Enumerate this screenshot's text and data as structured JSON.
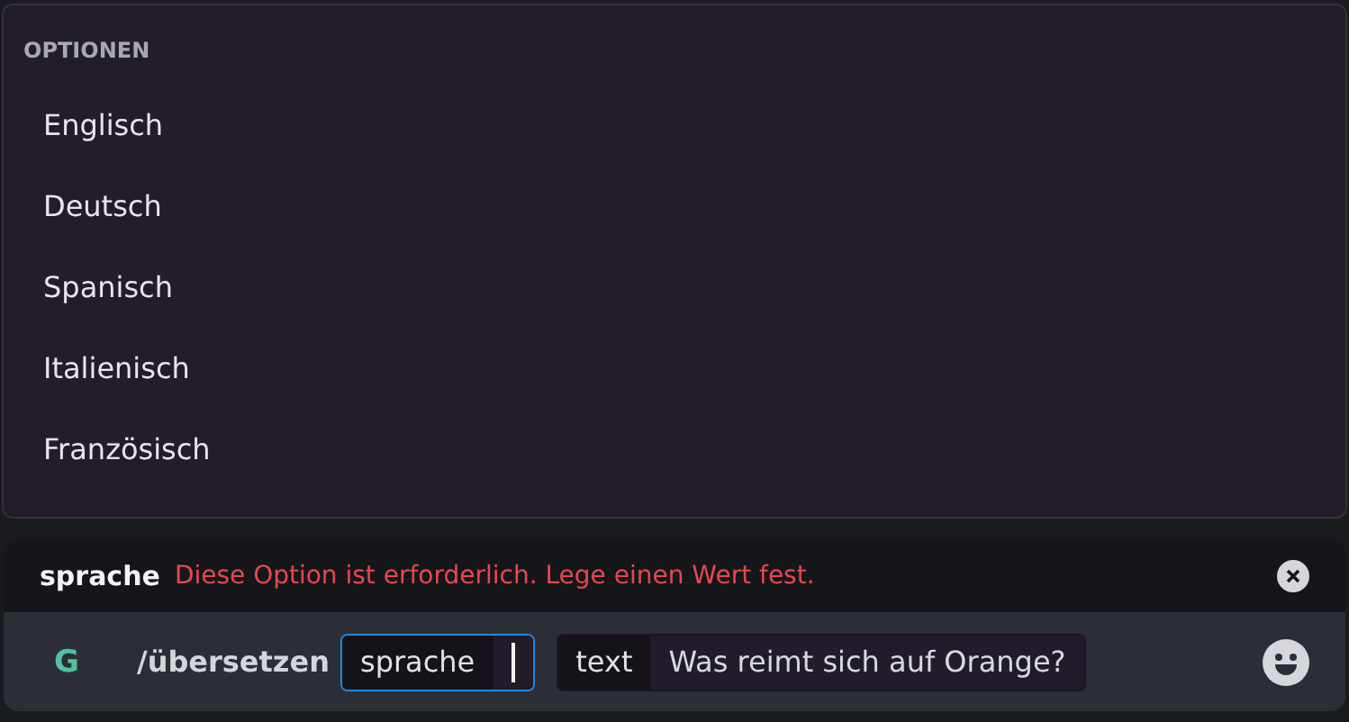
{
  "options_menu": {
    "heading": "OPTIONEN",
    "items": [
      {
        "label": "Englisch"
      },
      {
        "label": "Deutsch"
      },
      {
        "label": "Spanisch"
      },
      {
        "label": "Italienisch"
      },
      {
        "label": "Französisch"
      }
    ]
  },
  "error_bar": {
    "option": "sprache",
    "message": "Diese Option ist erforderlich. Lege einen Wert fest."
  },
  "command_bar": {
    "app_letter": "G",
    "command": "/übersetzen",
    "params": [
      {
        "name": "sprache",
        "focused": true
      },
      {
        "name": "text",
        "value": "Was reimt sich auf Orange?",
        "focused": false
      }
    ]
  }
}
